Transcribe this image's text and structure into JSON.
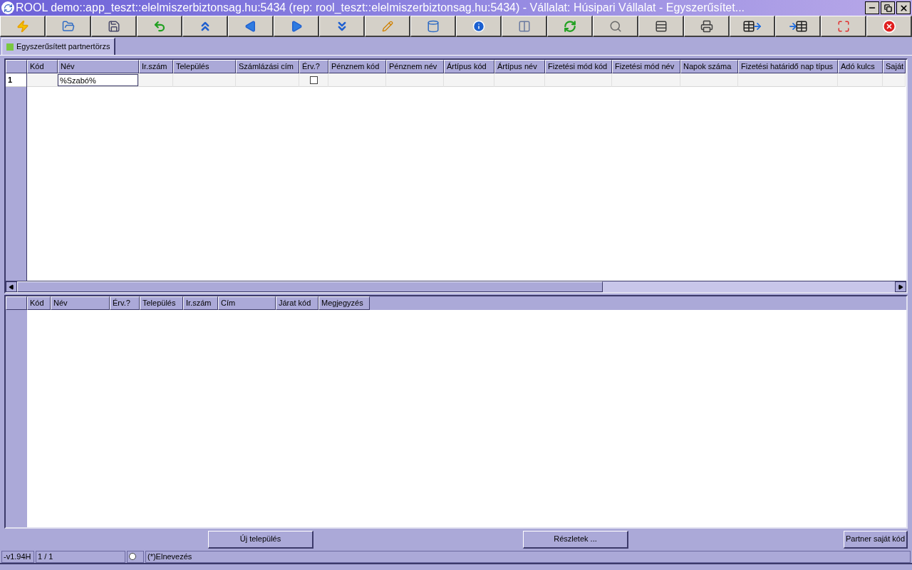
{
  "window": {
    "title": "ROOL demo::app_teszt::elelmiszerbiztonsag.hu:5434 (rep: rool_teszt::elelmiszerbiztonsag.hu:5434) - Vállalat: Húsipari Vállalat - Egyszerűsítet..."
  },
  "tabs": [
    {
      "label": "Egyszerűsített partnertörzs",
      "selected": true
    }
  ],
  "upper_grid": {
    "columns": [
      "Kód",
      "Név",
      "Ir.szám",
      "Település",
      "Számlázási cím",
      "Érv.?",
      "Pénznem kód",
      "Pénznem név",
      "Ártípus kód",
      "Ártípus név",
      "Fizetési mód kód",
      "Fizetési mód név",
      "Napok száma",
      "Fizetési határidő nap típus",
      "Adó kulcs",
      "Saját"
    ],
    "rows": [
      {
        "number": "1",
        "name_filter": "%Szabó%",
        "valid": false
      }
    ]
  },
  "lower_grid": {
    "columns": [
      "Kód",
      "Név",
      "Érv.?",
      "Település",
      "Ir.szám",
      "Cím",
      "Járat kód",
      "Megjegyzés"
    ]
  },
  "buttons": [
    "Új település",
    "Részletek ...",
    "Partner saját kód"
  ],
  "status_bar": {
    "version": "-v1.94H",
    "record": "1 / 1",
    "label": "(*)Elnevezés"
  }
}
